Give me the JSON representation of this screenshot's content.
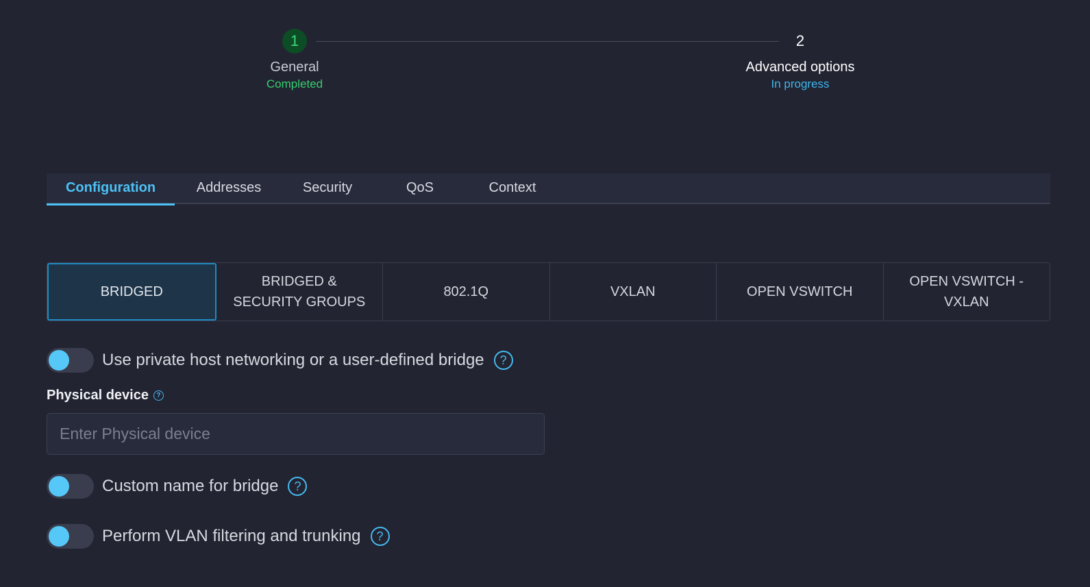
{
  "stepper": {
    "steps": [
      {
        "number": "1",
        "title": "General",
        "status": "Completed"
      },
      {
        "number": "2",
        "title": "Advanced options",
        "status": "In progress"
      }
    ]
  },
  "tabs": [
    {
      "label": "Configuration",
      "active": true
    },
    {
      "label": "Addresses",
      "active": false
    },
    {
      "label": "Security",
      "active": false
    },
    {
      "label": "QoS",
      "active": false
    },
    {
      "label": "Context",
      "active": false
    }
  ],
  "modes": [
    {
      "line1": "BRIDGED",
      "line2": "",
      "active": true
    },
    {
      "line1": "BRIDGED &",
      "line2": "SECURITY GROUPS",
      "active": false
    },
    {
      "line1": "802.1Q",
      "line2": "",
      "active": false
    },
    {
      "line1": "VXLAN",
      "line2": "",
      "active": false
    },
    {
      "line1": "OPEN VSWITCH",
      "line2": "",
      "active": false
    },
    {
      "line1": "OPEN VSWITCH -",
      "line2": "VXLAN",
      "active": false
    }
  ],
  "toggles": {
    "private_host": {
      "label": "Use private host networking or a user-defined bridge"
    },
    "custom_bridge": {
      "label": "Custom name for bridge"
    },
    "vlan_filtering": {
      "label": "Perform VLAN filtering and trunking"
    }
  },
  "physical_device": {
    "label": "Physical device",
    "value": "",
    "placeholder": "Enter Physical device"
  },
  "help_glyph": "?",
  "colors": {
    "background": "#222431",
    "accent": "#4cc1f5",
    "completed": "#34d06e",
    "in_progress": "#3fb6ee"
  }
}
